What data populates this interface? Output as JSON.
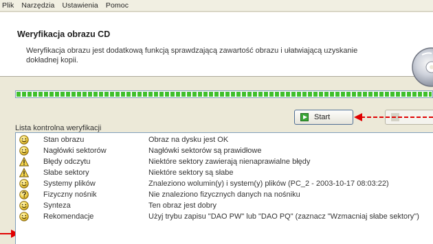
{
  "menu": [
    {
      "label": "Plik"
    },
    {
      "label": "Narzędzia"
    },
    {
      "label": "Ustawienia"
    },
    {
      "label": "Pomoc"
    }
  ],
  "header": {
    "title": "Weryfikacja obrazu CD",
    "description": "Weryfikacja obrazu jest dodatkową funkcją sprawdzającą zawartość obrazu i ułatwiającą uzyskanie dokładnej kopii."
  },
  "progress": {
    "value_percent": 100,
    "color": "#3fbf2c"
  },
  "buttons": {
    "start_label": "Start"
  },
  "annotation_color": "#e00000",
  "checklist": {
    "label": "Lista kontrolna weryfikacji",
    "items": [
      {
        "icon": "smiley-ok-icon",
        "name": "Stan obrazu",
        "value": "Obraz na dysku jest OK"
      },
      {
        "icon": "smiley-ok-icon",
        "name": "Nagłówki sektorów",
        "value": "Nagłówki sektorów są prawidłowe"
      },
      {
        "icon": "warning-icon",
        "name": "Błędy odczytu",
        "value": "Niektóre sektory zawierają nienaprawialne błędy"
      },
      {
        "icon": "warning-icon",
        "name": "Słabe sektory",
        "value": "Niektóre sektory są słabe"
      },
      {
        "icon": "smiley-ok-icon",
        "name": "Systemy plików",
        "value": "Znaleziono wolumin(y) i system(y) plików (PC_2 - 2003-10-17 08:03:22)"
      },
      {
        "icon": "question-icon",
        "name": "Fizyczny nośnik",
        "value": "Nie znaleziono fizycznych danych na nośniku"
      },
      {
        "icon": "smiley-ok-icon",
        "name": "Synteza",
        "value": "Ten obraz jest dobry"
      },
      {
        "icon": "smiley-ok-icon",
        "name": "Rekomendacje",
        "value": "Użyj trybu zapisu \"DAO PW\" lub \"DAO PQ\" (zaznacz \"Wzmacniaj słabe sektory\")"
      }
    ]
  }
}
